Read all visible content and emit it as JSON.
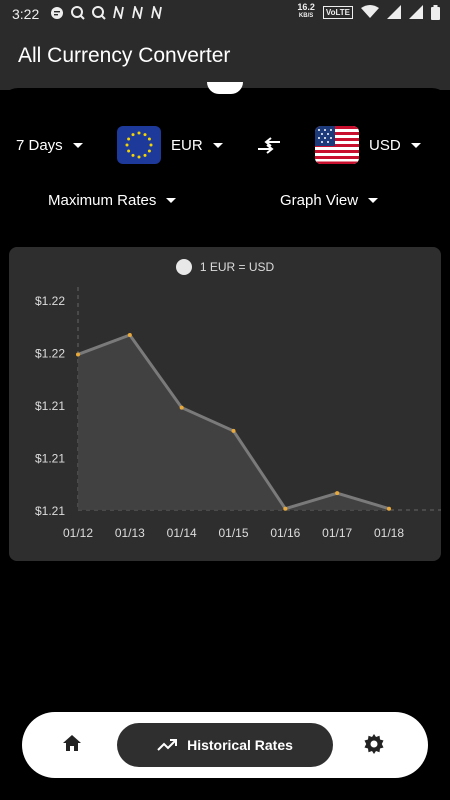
{
  "status_bar": {
    "time": "3:22",
    "net_speed_value": "16.2",
    "net_speed_unit": "KB/S",
    "volte": "VoLTE"
  },
  "app": {
    "title": "All Currency Converter"
  },
  "controls": {
    "period": "7 Days",
    "from_currency": "EUR",
    "to_currency": "USD",
    "rate_type": "Maximum Rates",
    "view_mode": "Graph View"
  },
  "chart_data": {
    "type": "area",
    "legend": "1 EUR = USD",
    "x": [
      "01/12",
      "01/13",
      "01/14",
      "01/15",
      "01/16",
      "01/17",
      "01/18"
    ],
    "values": [
      1.2196,
      1.2211,
      1.2155,
      1.2137,
      1.2077,
      1.2089,
      1.2077
    ],
    "y_ticks": [
      "$1.22",
      "$1.22",
      "$1.21",
      "$1.21",
      "$1.21"
    ],
    "ylim": [
      1.2076,
      1.2238
    ],
    "series_color": "#7a7a7a",
    "point_color": "#e8a93a",
    "grid": false
  },
  "bottom_nav": {
    "active_label": "Historical Rates"
  }
}
